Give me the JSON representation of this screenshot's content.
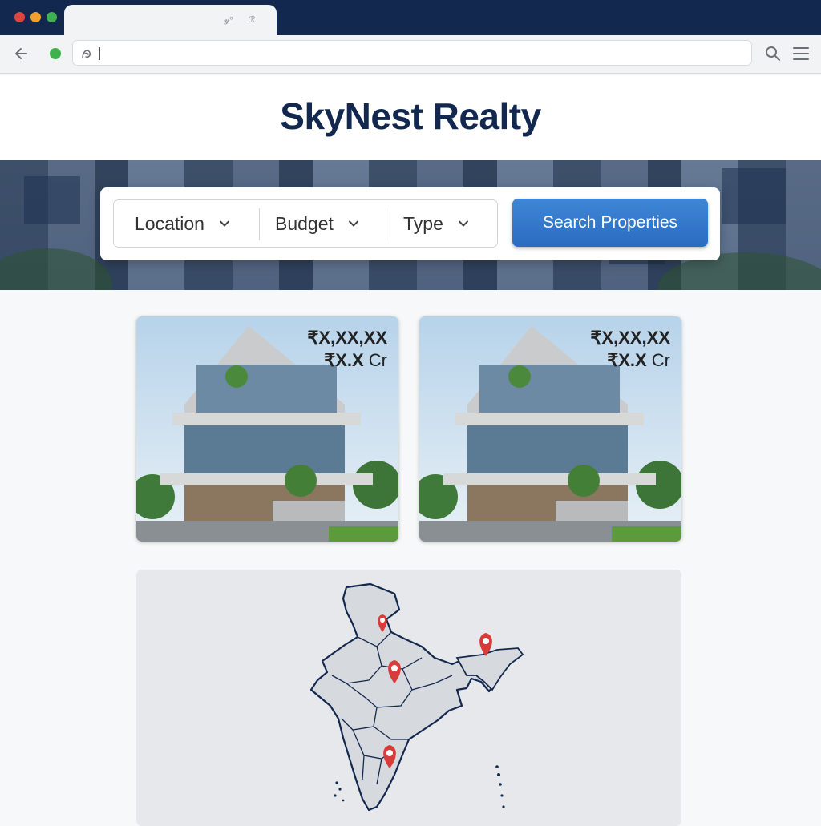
{
  "browser": {
    "tab_glyphs": [
      "𝓎ᵒ",
      "ℛ"
    ],
    "window_dots": [
      "#e0443e",
      "#f0a12c",
      "#3fb24f"
    ]
  },
  "brand": {
    "name": "SkyNest Realty",
    "color": "#13284f"
  },
  "search": {
    "filters": [
      {
        "label": "Location"
      },
      {
        "label": "Budget"
      },
      {
        "label": "Type"
      }
    ],
    "button_label": "Search Properties",
    "button_color": "#2f74c8"
  },
  "listings": [
    {
      "price_line1": "₹X,XX,XX",
      "price_line2_symbol": "₹X.X",
      "price_line2_unit": " Cr"
    },
    {
      "price_line1": "₹X,XX,XX",
      "price_line2_symbol": "₹X.X",
      "price_line2_unit": " Cr"
    }
  ],
  "map": {
    "region": "India",
    "pin_color": "#d93a3a",
    "pins": [
      {
        "place": "north"
      },
      {
        "place": "central"
      },
      {
        "place": "northeast"
      },
      {
        "place": "south"
      }
    ]
  },
  "icons": {
    "back": "arrow-left-icon",
    "secure": "secure-dot-icon",
    "site": "site-favicon-icon",
    "search": "search-icon",
    "menu": "hamburger-menu-icon",
    "dropdown": "chevron-down-icon",
    "map_pin": "map-pin-icon"
  }
}
